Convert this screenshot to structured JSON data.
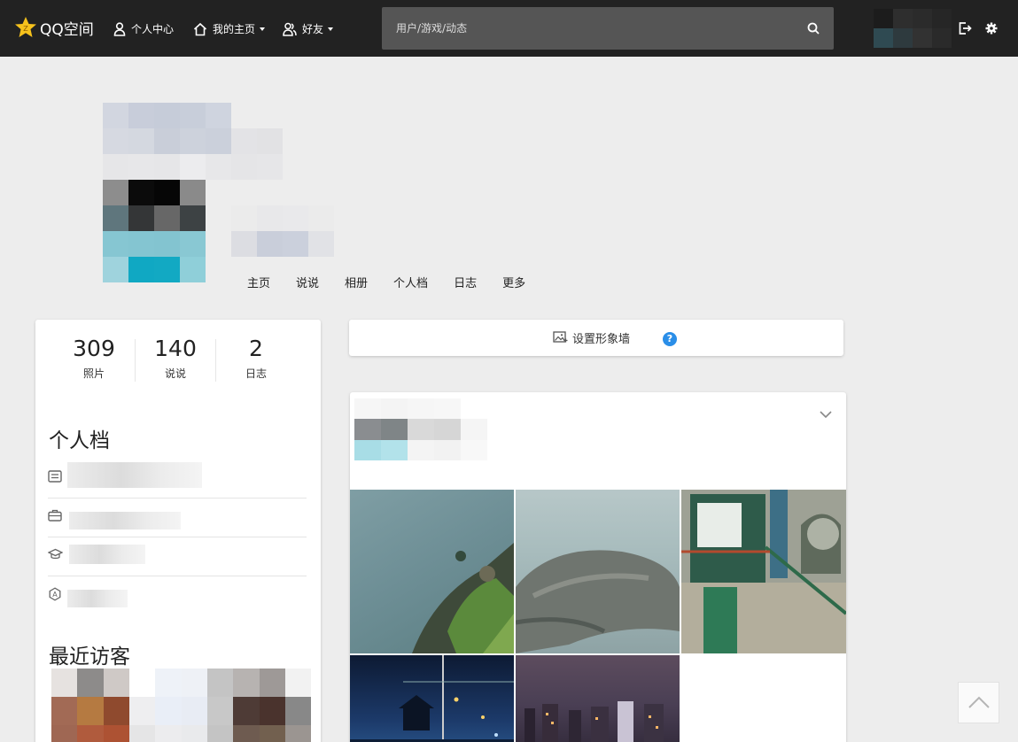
{
  "topbar": {
    "logo_text": "QQ空间",
    "nav": [
      {
        "label": "个人中心",
        "icon": "person-icon",
        "has_caret": false
      },
      {
        "label": "我的主页",
        "icon": "home-icon",
        "has_caret": true
      },
      {
        "label": "好友",
        "icon": "friends-icon",
        "has_caret": true
      }
    ],
    "search_placeholder": "用户/游戏/动态"
  },
  "profile_tabs": [
    "主页",
    "说说",
    "相册",
    "个人档",
    "日志",
    "更多"
  ],
  "stats": [
    {
      "value": "309",
      "label": "照片"
    },
    {
      "value": "140",
      "label": "说说"
    },
    {
      "value": "2",
      "label": "日志"
    }
  ],
  "profile_section": {
    "title": "个人档",
    "rows": [
      {
        "icon": "id-card-icon"
      },
      {
        "icon": "briefcase-icon"
      },
      {
        "icon": "graduation-cap-icon"
      },
      {
        "icon": "zodiac-icon"
      }
    ]
  },
  "visitors_title": "最近访客",
  "wall": {
    "button_label": "设置形象墙",
    "help_label": "?"
  },
  "colors": {
    "topbar": "#222222",
    "accent_blue": "#2a8ee8",
    "page_bg": "#ededed"
  }
}
